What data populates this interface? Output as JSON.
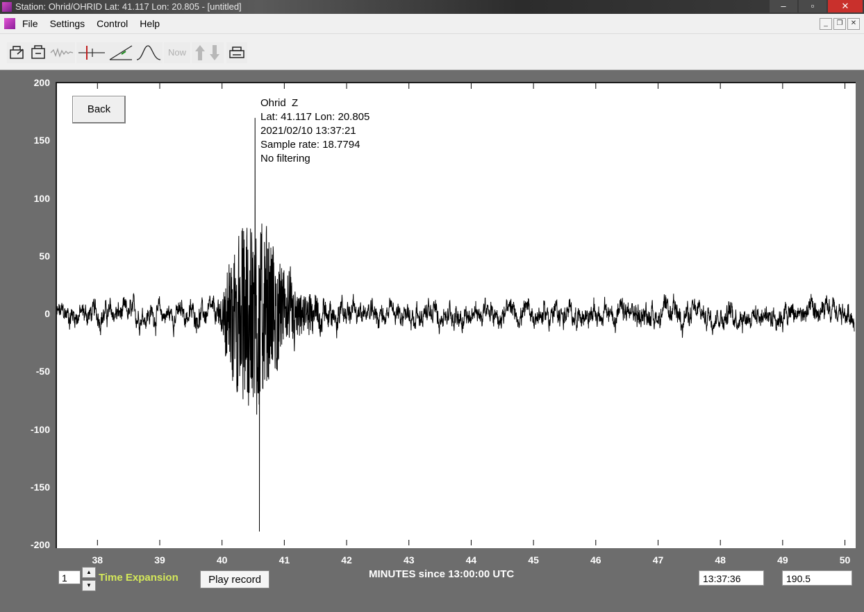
{
  "window": {
    "title": "Station: Ohrid/OHRID Lat: 41.117 Lon: 20.805 - [untitled]",
    "min_label": "–",
    "max_label": "▫",
    "close_label": "✕"
  },
  "menu": {
    "items": [
      "File",
      "Settings",
      "Control",
      "Help"
    ],
    "mdi_min": "_",
    "mdi_restore": "❐",
    "mdi_close": "✕"
  },
  "toolbar": {
    "now_label": "Now",
    "icons": [
      "open-file-icon",
      "save-file-icon",
      "waveform-icon",
      "pick-marker-icon",
      "ramp-icon",
      "spectrum-icon",
      "now-button",
      "scale-up-down-icon",
      "printer-icon"
    ]
  },
  "plot": {
    "back_label": "Back",
    "info": {
      "station": "Ohrid  Z",
      "location": "Lat: 41.117 Lon: 20.805",
      "datetime": "2021/02/10 13:37:21",
      "sample_rate": "Sample rate: 18.7794",
      "filter": "No filtering"
    },
    "colors": {
      "background": "#ffffff",
      "trace": "#000000",
      "frame": "#6d6d6d",
      "axis_text": "#ffffff"
    }
  },
  "chart_data": {
    "type": "line",
    "title": "",
    "xlabel": "MINUTES since 13:00:00 UTC",
    "ylabel": "",
    "xlim": [
      37.35,
      50.15
    ],
    "ylim": [
      -200,
      200
    ],
    "x_ticks": [
      "38",
      "39",
      "40",
      "41",
      "42",
      "43",
      "44",
      "45",
      "46",
      "47",
      "48",
      "49",
      "50"
    ],
    "y_ticks": [
      "200",
      "150",
      "100",
      "50",
      "0",
      "-50",
      "-100",
      "-150",
      "-200"
    ],
    "grid": false,
    "series": [
      {
        "values_description_excluded": true,
        "event_onset_min": 39.9,
        "peak_positive": 170,
        "peak_negative": -188,
        "peak_time_min": 40.6,
        "coda_end_min": 42.0,
        "background_noise_amplitude": 20
      }
    ]
  },
  "controls": {
    "time_expansion_value": "1",
    "time_expansion_label": "Time Expansion",
    "play_label": "Play record",
    "time_readout": "13:37:36",
    "value_readout": "190.5"
  }
}
